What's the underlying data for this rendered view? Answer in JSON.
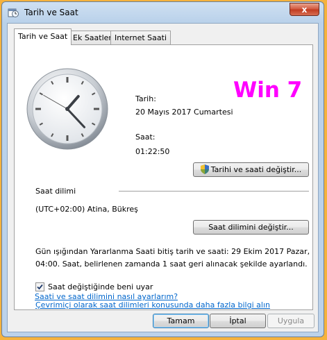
{
  "window": {
    "title": "Tarih ve Saat",
    "close_glyph": "x"
  },
  "tabs": [
    {
      "label": "Tarih ve Saat",
      "active": true
    },
    {
      "label": "Ek Saatler",
      "active": false
    },
    {
      "label": "Internet Saati",
      "active": false
    }
  ],
  "datetime": {
    "date_label": "Tarih:",
    "date_value": "20 Mayıs 2017 Cumartesi",
    "time_label": "Saat:",
    "time_value": "01:22:50",
    "change_button": "Tarihi ve saati değiştir..."
  },
  "overlay_text": "Win 7",
  "timezone": {
    "section_label": "Saat dilimi",
    "value": "(UTC+02:00) Atina, Bükreş",
    "change_button": "Saat dilimini değiştir..."
  },
  "dst": {
    "line1": "Gün ışığından Yararlanma Saati bitiş tarih ve saati: 29 Ekim 2017 Pazar,",
    "line2": "04:00. Saat, belirlenen zamanda 1 saat geri alınacak şekilde ayarlandı."
  },
  "notify": {
    "label": "Saat değiştiğinde beni uyar",
    "checked": true
  },
  "links": {
    "online_info": "Çevrimiçi olarak saat dilimleri konusunda daha fazla bilgi alın",
    "how_to": "Saati ve saat dilimini nasıl ayarlarım?"
  },
  "footer": {
    "ok": "Tamam",
    "cancel": "İptal",
    "apply": "Uygula"
  },
  "clock": {
    "hour": 1,
    "minute": 22,
    "second": 50
  },
  "colors": {
    "overlay": "#ff00ff",
    "link": "#0066cc"
  }
}
